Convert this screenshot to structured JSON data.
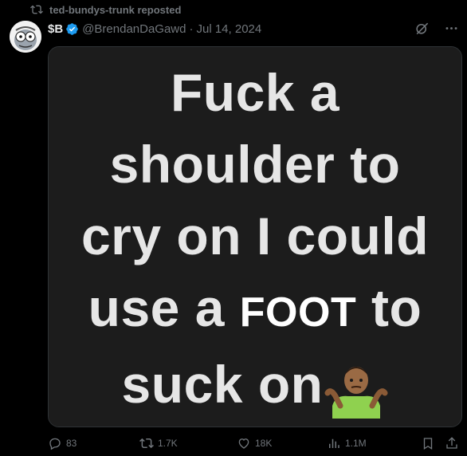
{
  "repost": {
    "text": "ted-bundys-trunk reposted",
    "icon": "repost-icon"
  },
  "author": {
    "display_name": "$B",
    "handle": "@BrendanDaGawd",
    "separator": "·",
    "date": "Jul 14, 2024",
    "verified": true
  },
  "meme": {
    "line1": "Fuck a",
    "line2": "shoulder to",
    "line3": "cry on I could",
    "line4_pre": "use a",
    "line4_emph": "FOOT",
    "line4_post": "to",
    "line5": "suck on",
    "emoji": "shrug-emoji"
  },
  "actions": {
    "replies": "83",
    "reposts": "1.7K",
    "likes": "18K",
    "views": "1.1M"
  },
  "colors": {
    "background": "#000000",
    "muted": "#71767b",
    "verified": "#1d9bf0"
  }
}
